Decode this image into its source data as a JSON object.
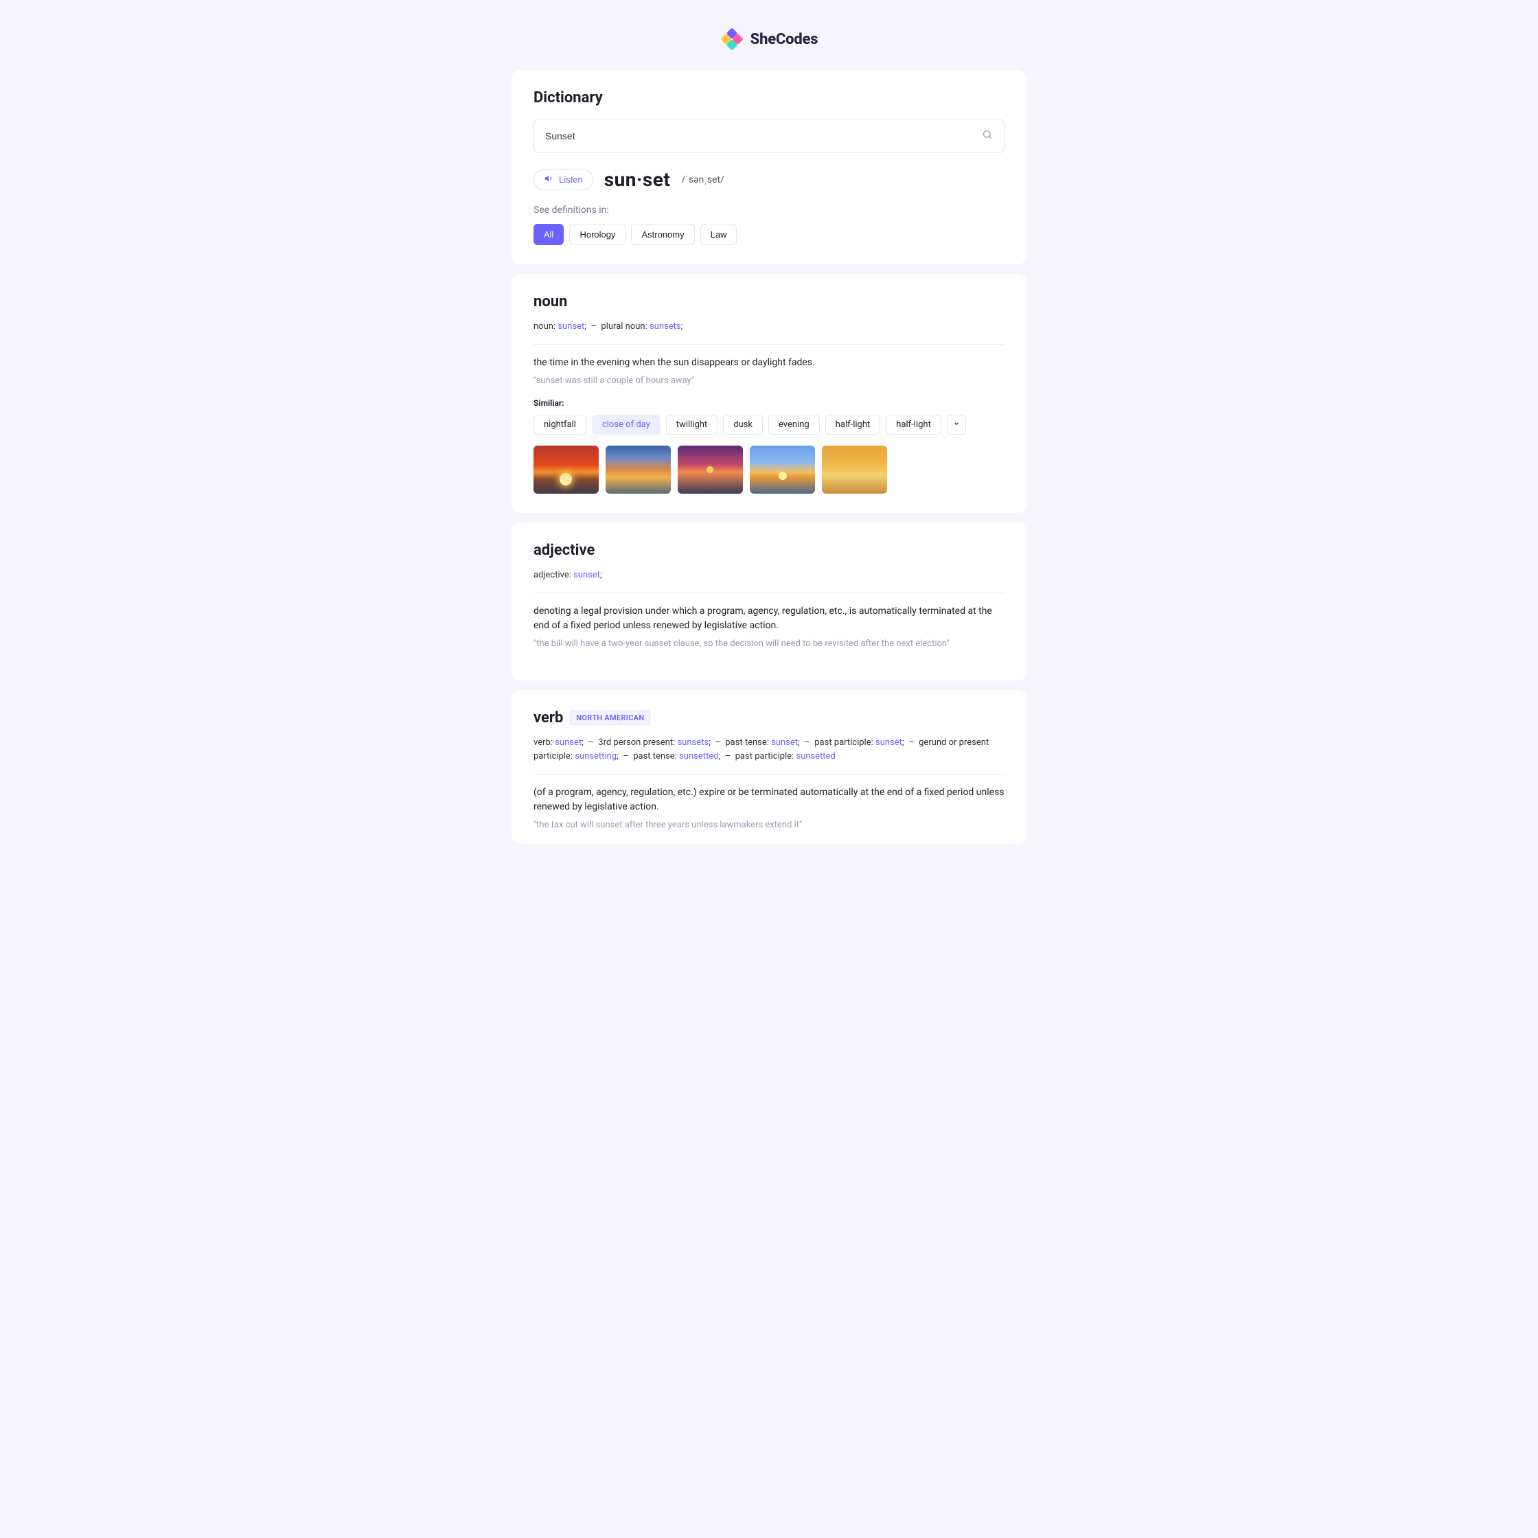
{
  "brand": "SheCodes",
  "header": {
    "title": "Dictionary",
    "search_value": "Sunset"
  },
  "listen_label": "Listen",
  "headword": "sun·set",
  "phonetic": "/ˈsənˌset/",
  "see_label": "See definitions in:",
  "filter_chips": [
    "All",
    "Horology",
    "Astronomy",
    "Law"
  ],
  "filter_active_index": 0,
  "noun": {
    "title": "noun",
    "forms_html": "noun: <span class='kw'>sunset</span>;  –  plural noun: <span class='kw'>sunsets</span>;",
    "definition": "the time in the evening when the sun disappears or daylight fades.",
    "example": "\"sunset was still a couple of hours away\"",
    "similar_label": "Similiar:",
    "similar": [
      {
        "text": "nightfall",
        "highlight": false
      },
      {
        "text": "close of day",
        "highlight": true
      },
      {
        "text": "twillight",
        "highlight": false
      },
      {
        "text": "dusk",
        "highlight": false
      },
      {
        "text": "evening",
        "highlight": false
      },
      {
        "text": "half-light",
        "highlight": false
      },
      {
        "text": "half-light",
        "highlight": false
      }
    ]
  },
  "adjective": {
    "title": "adjective",
    "forms_html": "adjective: <span class='kw'>sunset</span>;",
    "definition": "denoting a legal provision under which a program, agency, regulation, etc., is automatically terminated at the end of a fixed period unless renewed by legislative action.",
    "example": "\"the bill will have a two-year sunset clause, so the decision will need to be revisited after the next election\""
  },
  "verb": {
    "title": "verb",
    "tag": "NORTH AMERICAN",
    "forms_html": "verb: <span class='kw'>sunset</span>;  –  3rd person present: <span class='kw'>sunsets</span>;  –  past tense: <span class='kw'>sunset</span>;  –  past participle: <span class='kw'>sunset</span>;  –  gerund or present participle: <span class='kw'>sunsetting</span>;  –  past tense: <span class='kw'>sunsetted</span>;  –  past participle: <span class='kw'>sunsetted</span>",
    "definition": "(of a program, agency, regulation, etc.) expire or be terminated automatically at the end of a fixed period unless renewed by legislative action.",
    "example": "\"the tax cut will sunset after three years unless lawmakers extend it\""
  }
}
